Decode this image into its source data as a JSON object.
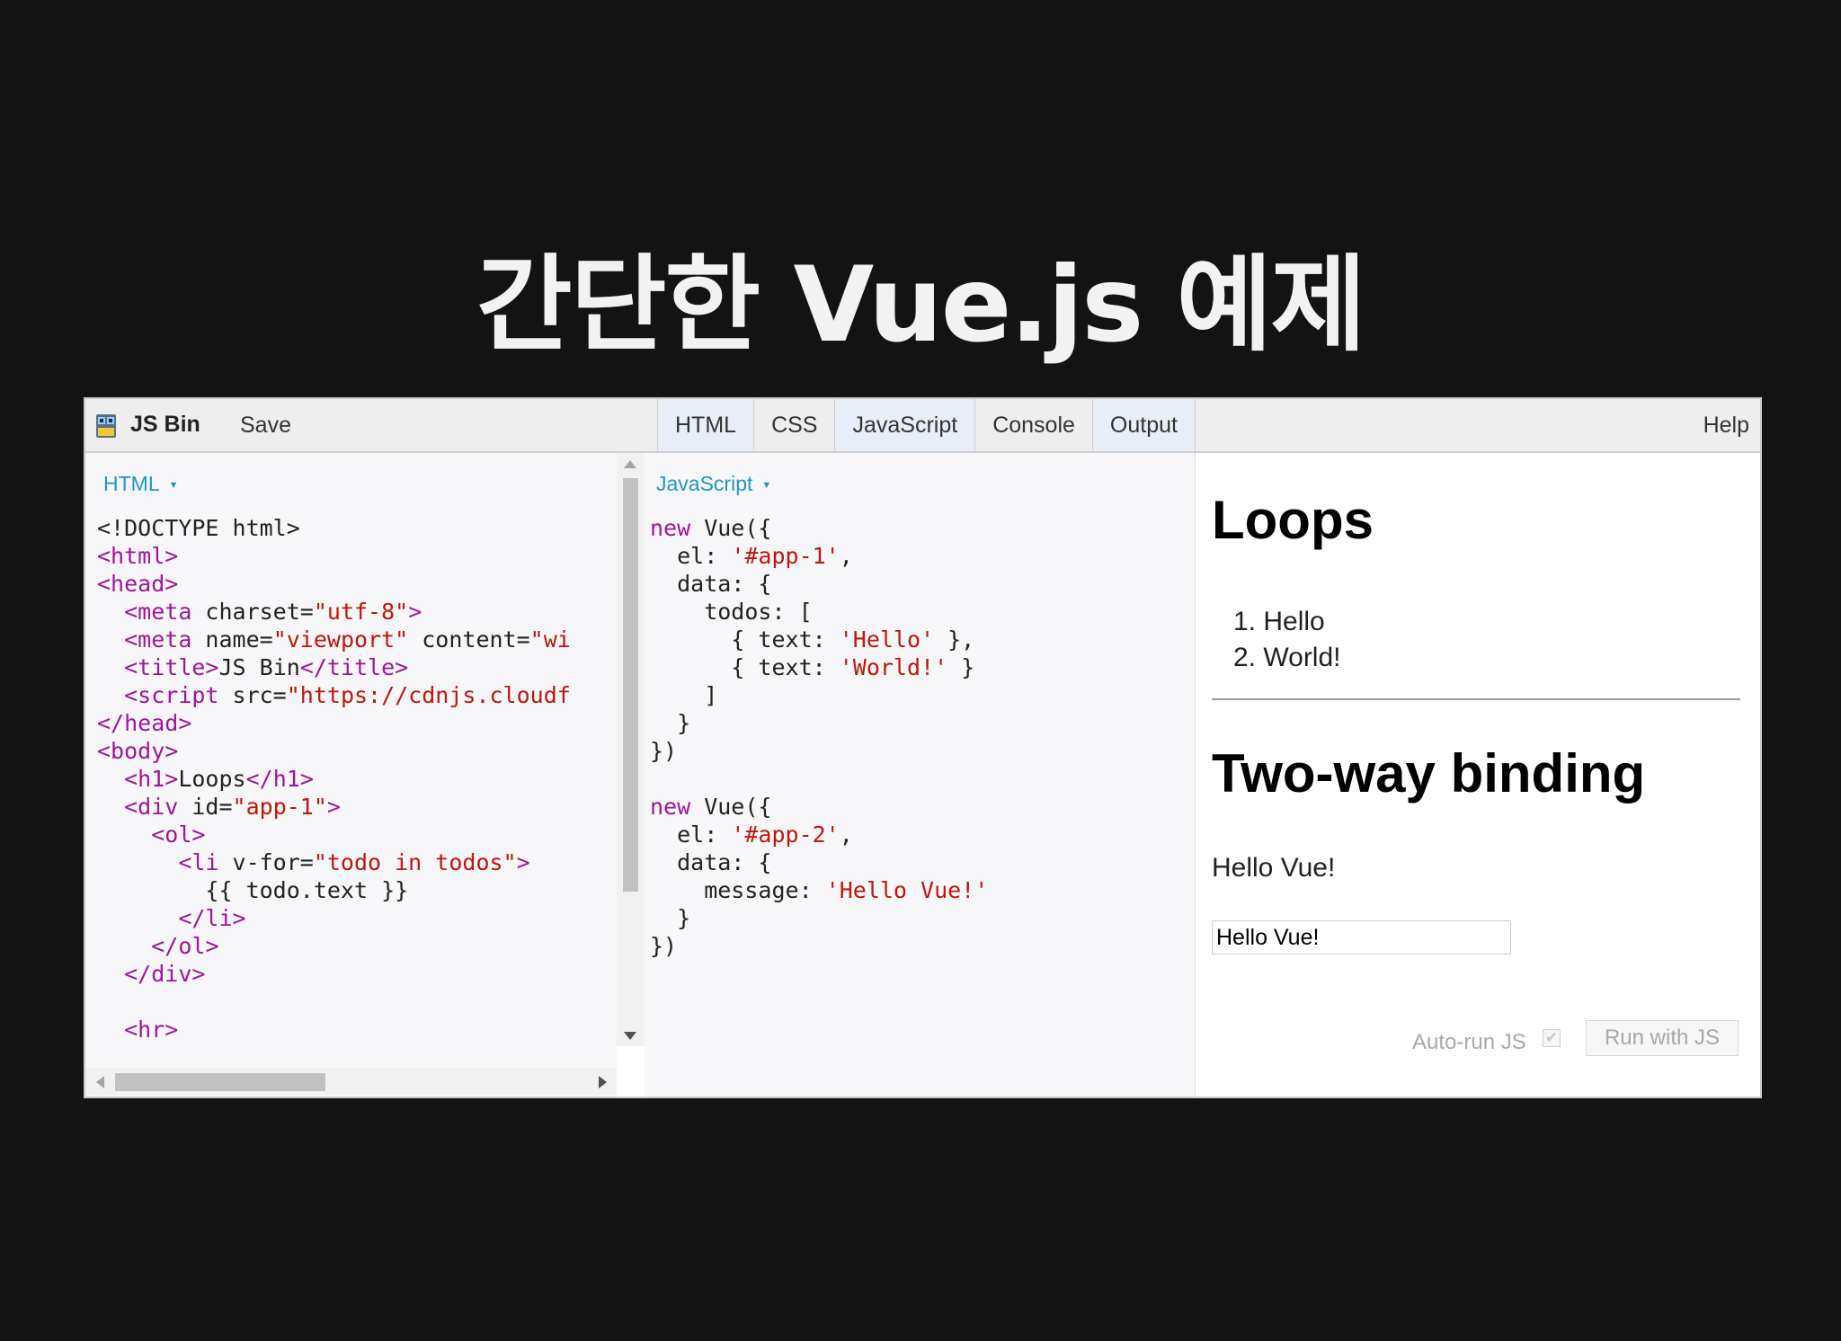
{
  "slide": {
    "title": "간단한 Vue.js 예제"
  },
  "app": {
    "brand": "JS Bin",
    "save": "Save",
    "tabs": [
      "HTML",
      "CSS",
      "JavaScript",
      "Console",
      "Output"
    ],
    "help": "Help",
    "logo_icon": "jsbin-robot-icon"
  },
  "html_panel": {
    "label": "HTML",
    "lines": [
      "<!DOCTYPE html>",
      "<html>",
      "<head>",
      "  <meta charset=\"utf-8\">",
      "  <meta name=\"viewport\" content=\"wi",
      "  <title>JS Bin</title>",
      "  <script src=\"https://cdnjs.cloudf",
      "</head>",
      "<body>",
      "  <h1>Loops</h1>",
      "  <div id=\"app-1\">",
      "    <ol>",
      "      <li v-for=\"todo in todos\">",
      "        {{ todo.text }}",
      "      </li>",
      "    </ol>",
      "  </div>",
      "",
      "  <hr>"
    ]
  },
  "js_panel": {
    "label": "JavaScript",
    "lines": [
      "new Vue({",
      "  el: '#app-1',",
      "  data: {",
      "    todos: [",
      "      { text: 'Hello' },",
      "      { text: 'World!' }",
      "    ]",
      "  }",
      "})",
      "",
      "new Vue({",
      "  el: '#app-2',",
      "  data: {",
      "    message: 'Hello Vue!'",
      "  }",
      "})"
    ]
  },
  "output": {
    "heading1": "Loops",
    "list": [
      "1.  Hello",
      "2.  World!"
    ],
    "heading2": "Two-way binding",
    "message": "Hello Vue!",
    "input_value": "Hello Vue!",
    "autorun_label": "Auto-run JS",
    "autorun_checked": true,
    "run_button": "Run with JS"
  },
  "colors": {
    "tag": "#a0159b",
    "attribute": "#8a5a00",
    "string": "#c0160b",
    "panel_label": "#2196c8"
  }
}
